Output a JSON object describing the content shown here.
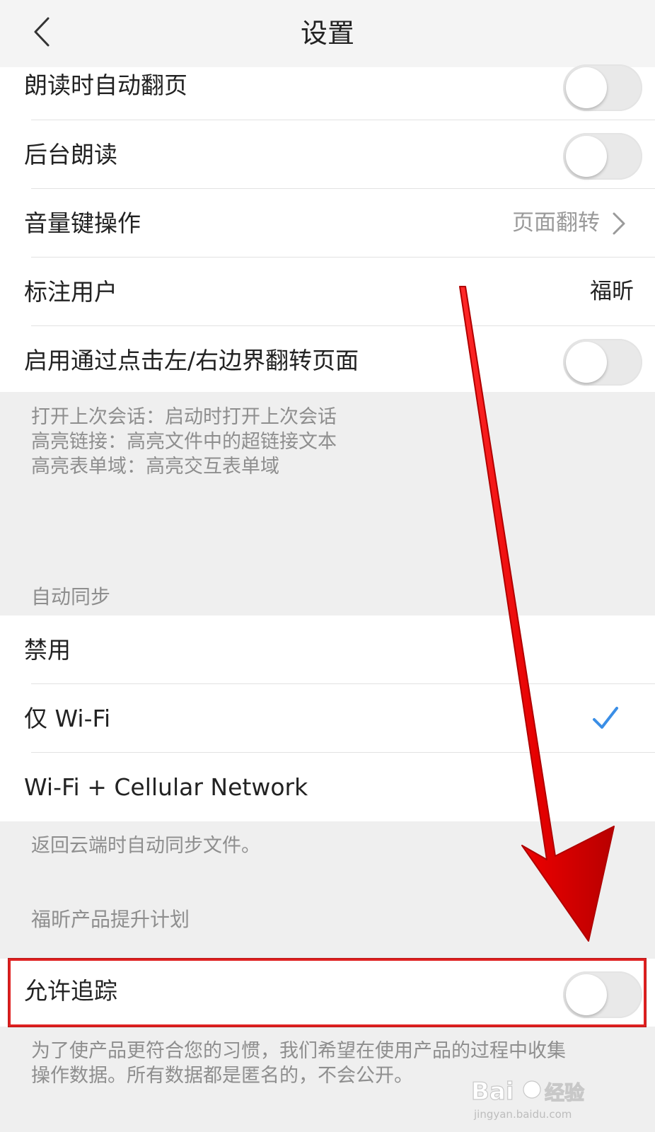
{
  "header": {
    "title": "设置",
    "back_icon": "chevron-left-icon"
  },
  "reading_settings": {
    "rows": [
      {
        "label": "朗读时自动翻页",
        "control": "toggle",
        "on": false
      },
      {
        "label": "后台朗读",
        "control": "toggle",
        "on": false
      },
      {
        "label": "音量键操作",
        "control": "value-chevron",
        "value": "页面翻转"
      },
      {
        "label": "标注用户",
        "control": "value",
        "value": "福昕"
      },
      {
        "label": "启用通过点击左/右边界翻转页面",
        "control": "toggle",
        "on": false
      }
    ],
    "notes": [
      "打开上次会话：启动时打开上次会话",
      "高亮链接：高亮文件中的超链接文本",
      "高亮表单域：高亮交互表单域"
    ]
  },
  "auto_sync": {
    "header": "自动同步",
    "options": [
      {
        "label": "禁用",
        "selected": false
      },
      {
        "label": "仅 Wi-Fi",
        "selected": true
      },
      {
        "label": "Wi-Fi + Cellular Network",
        "selected": false
      }
    ],
    "note": "返回云端时自动同步文件。"
  },
  "improvement_program": {
    "header": "福昕产品提升计划",
    "row": {
      "label": "允许追踪",
      "on": false
    },
    "note_lines": [
      "为了使产品更符合您的习惯，我们希望在使用产品的过程中收集",
      "操作数据。所有数据都是匿名的，不会公开。"
    ]
  },
  "watermark": {
    "brand": "Bai",
    "brand_cn": "经验",
    "site": "jingyan.baidu.com"
  },
  "colors": {
    "check": "#3a8ee6",
    "annotation_red": "#e02020",
    "toggle_off": "#e9e9e9",
    "background": "#efefef"
  }
}
